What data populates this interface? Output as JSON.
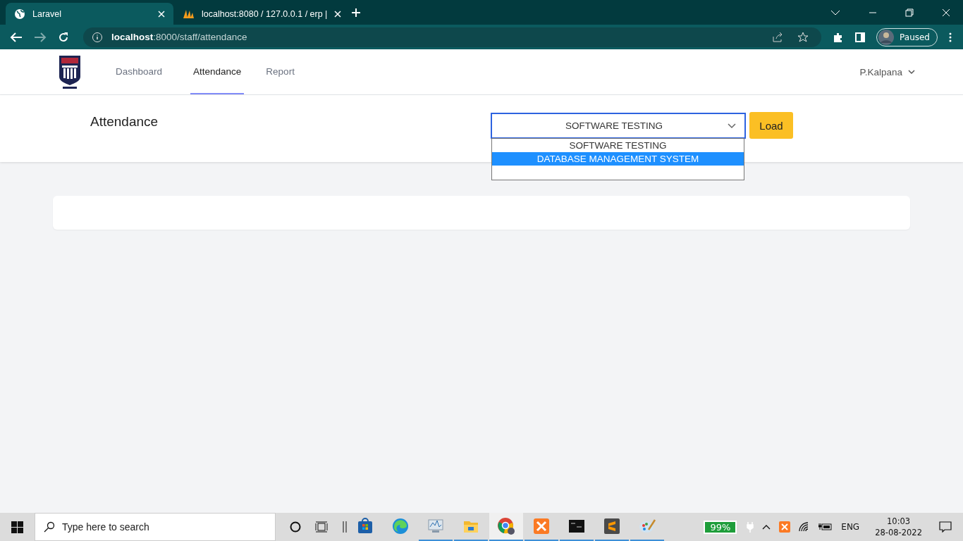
{
  "browser": {
    "tabs": [
      {
        "title": "Laravel",
        "kind": "globe",
        "selected": true
      },
      {
        "title": "localhost:8080 / 127.0.0.1 / erp |",
        "kind": "sailboat",
        "selected": false
      }
    ],
    "url_host": "localhost",
    "url_path": ":8000/staff/attendance",
    "profile_status": "Paused"
  },
  "nav": {
    "items": [
      {
        "label": "Dashboard",
        "selected": false
      },
      {
        "label": "Attendance",
        "selected": true
      },
      {
        "label": "Report",
        "selected": false
      }
    ],
    "user": "P.Kalpana"
  },
  "page": {
    "title": "Attendance",
    "select": {
      "value": "SOFTWARE TESTING",
      "expanded": true,
      "options": [
        {
          "label": "SOFTWARE TESTING",
          "highlighted": false
        },
        {
          "label": "DATABASE MANAGEMENT SYSTEM",
          "highlighted": true
        }
      ]
    },
    "load_button": "Load"
  },
  "taskbar": {
    "search_placeholder": "Type here to search",
    "apps": [
      {
        "kind": "store",
        "running": false,
        "active": false
      },
      {
        "kind": "edge",
        "running": false,
        "active": false
      },
      {
        "kind": "monitor",
        "running": true,
        "active": false
      },
      {
        "kind": "explorer",
        "running": true,
        "active": false
      },
      {
        "kind": "chrome",
        "running": true,
        "active": true
      },
      {
        "kind": "xampp",
        "running": true,
        "active": false
      },
      {
        "kind": "terminal",
        "running": true,
        "active": false
      },
      {
        "kind": "sublime",
        "running": true,
        "active": false
      },
      {
        "kind": "paint",
        "running": true,
        "active": false
      }
    ],
    "battery": "99%",
    "language": "ENG",
    "time": "10:03",
    "date": "28-08-2022"
  }
}
